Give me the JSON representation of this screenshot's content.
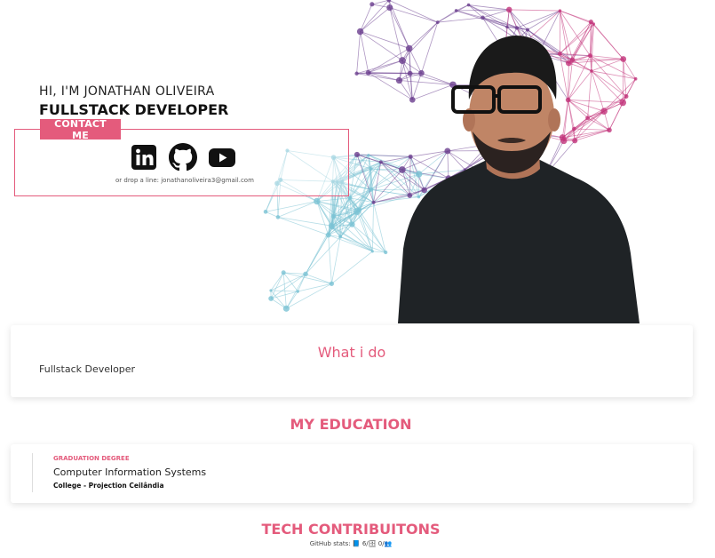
{
  "hero": {
    "greeting": "HI, I'M JONATHAN OLIVEIRA",
    "role": "FULLSTACK DEVELOPER",
    "contact_button": "CONTACT ME",
    "drop_line": "or drop a line: jonathanoliveira3@gmail.com"
  },
  "social": {
    "icons": [
      "linkedin-icon",
      "github-icon",
      "youtube-icon"
    ]
  },
  "what_i_do": {
    "title": "What i do",
    "text": "Fullstack Developer"
  },
  "education": {
    "title": "MY EDUCATION",
    "degree": "GRADUATION DEGREE",
    "course": "Computer Information Systems",
    "school": "College - Projection Ceilândia"
  },
  "tech": {
    "title": "TECH CONTRIBUITONS",
    "stats": "GitHub stats: 📘 6/🗄 0/👥"
  },
  "colors": {
    "accent": "#e45b7c",
    "network_teal": "#7cc3d4",
    "network_purple": "#6b3f8f",
    "network_pink": "#c2337a"
  }
}
